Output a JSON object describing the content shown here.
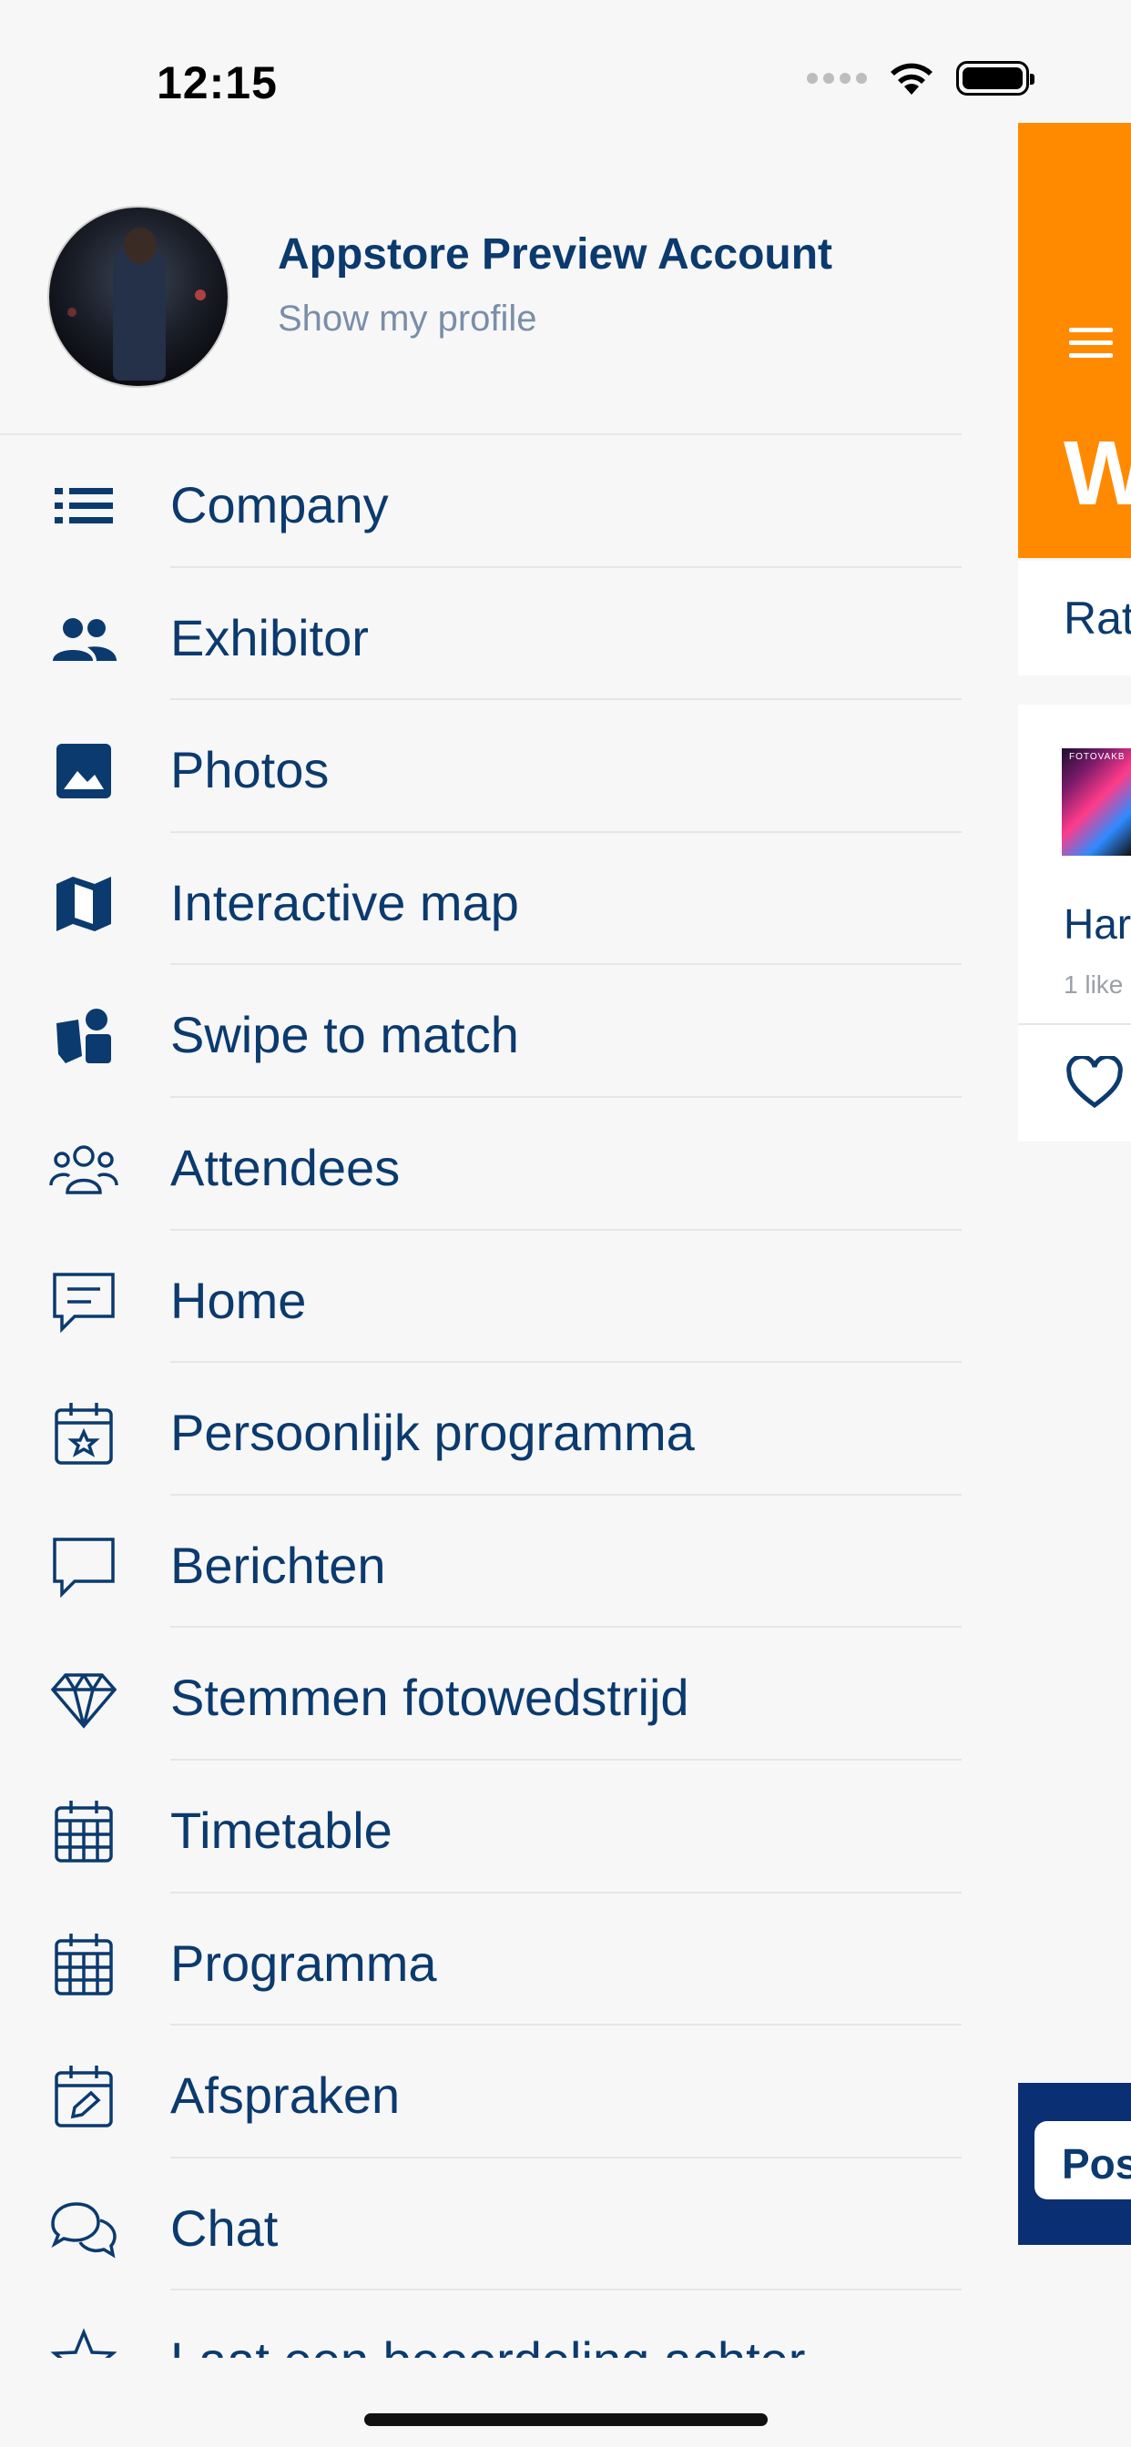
{
  "status_bar": {
    "time": "12:15"
  },
  "profile": {
    "name": "Appstore Preview Account",
    "link": "Show my profile"
  },
  "menu": {
    "items": [
      {
        "label": "Company",
        "icon": "list-icon"
      },
      {
        "label": "Exhibitor",
        "icon": "group-icon"
      },
      {
        "label": "Photos",
        "icon": "image-icon"
      },
      {
        "label": "Interactive map",
        "icon": "map-icon"
      },
      {
        "label": "Swipe to match",
        "icon": "swipe-match-icon"
      },
      {
        "label": "Attendees",
        "icon": "attendees-icon"
      },
      {
        "label": "Home",
        "icon": "message-icon"
      },
      {
        "label": "Persoonlijk programma",
        "icon": "calendar-star-icon"
      },
      {
        "label": "Berichten",
        "icon": "chat-bubble-icon"
      },
      {
        "label": "Stemmen fotowedstrijd",
        "icon": "diamond-icon"
      },
      {
        "label": "Timetable",
        "icon": "calendar-grid-icon"
      },
      {
        "label": "Programma",
        "icon": "calendar-grid-icon"
      },
      {
        "label": "Afspraken",
        "icon": "calendar-edit-icon"
      },
      {
        "label": "Chat",
        "icon": "chat-bubbles-icon"
      },
      {
        "label": "Laat een beoordeling achter",
        "icon": "star-icon"
      }
    ]
  },
  "background_page": {
    "header_big_text": "W",
    "card1_text": "Rat",
    "post_thumb_label": "FOTOVAKB",
    "post_title": "Har",
    "post_likes": "1 like",
    "footer_button": "Pos",
    "accent_color": "#ff8a00",
    "footer_color": "#0b2f73"
  },
  "colors": {
    "text_primary": "#0b3a6e",
    "text_secondary": "#7a8ea8",
    "background": "#f7f7f7"
  }
}
